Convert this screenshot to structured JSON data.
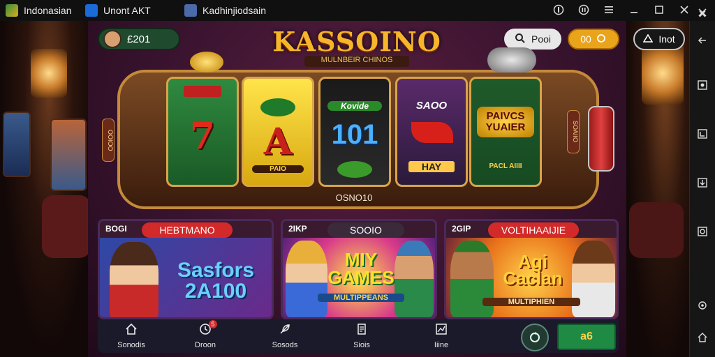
{
  "topbar": {
    "app_title": "Indonasian",
    "tab1": "Unont AKT",
    "tab2": "Kadhinjiodsain"
  },
  "header": {
    "balance": "£201",
    "logo": "KASSOINO",
    "logo_sub": "MULNBEIR CHINOS",
    "search_label": "Pooi",
    "coins_label": "00",
    "account_label": "Inot"
  },
  "slot": {
    "reels": [
      {
        "top": "",
        "main": "7",
        "bottom": ""
      },
      {
        "top": "",
        "main": "A",
        "bottom": "PAIO"
      },
      {
        "top": "Kovide",
        "main": "101",
        "bottom": ""
      },
      {
        "top": "SAOO",
        "main": "",
        "bottom": "HAY"
      },
      {
        "top": "",
        "main": "PAIVCS YUAIER",
        "bottom": "PACL AIIII"
      }
    ],
    "caption": "OSNO10",
    "left_tag": "OOIOO",
    "right_tag": "SOAIIO"
  },
  "cards": [
    {
      "corner": "BOGI",
      "pill": "HEBTMANO",
      "title": "Sasfors 2A100"
    },
    {
      "corner": "2IKP",
      "pill": "SOOIO",
      "title": "MIY GAMES",
      "subtitle": "MULTIPPEANS"
    },
    {
      "corner": "2GIP",
      "pill": "VOLTIHAAIJIE",
      "title": "Agi Caclan",
      "subtitle": "MULTIPHIEN"
    }
  ],
  "nav": {
    "items": [
      {
        "label": "Sonodis",
        "icon": "home-icon"
      },
      {
        "label": "Droon",
        "icon": "clock-icon"
      },
      {
        "label": "Sosods",
        "icon": "feather-icon"
      },
      {
        "label": "Siois",
        "icon": "document-icon"
      },
      {
        "label": "Iiine",
        "icon": "chart-icon"
      }
    ],
    "badge": "5",
    "play_label": "a6"
  },
  "colors": {
    "panel": "#3b1430",
    "green_reel": "#1f6b34",
    "gold": "#f6b52a",
    "pill_red": "#d22a2a"
  }
}
